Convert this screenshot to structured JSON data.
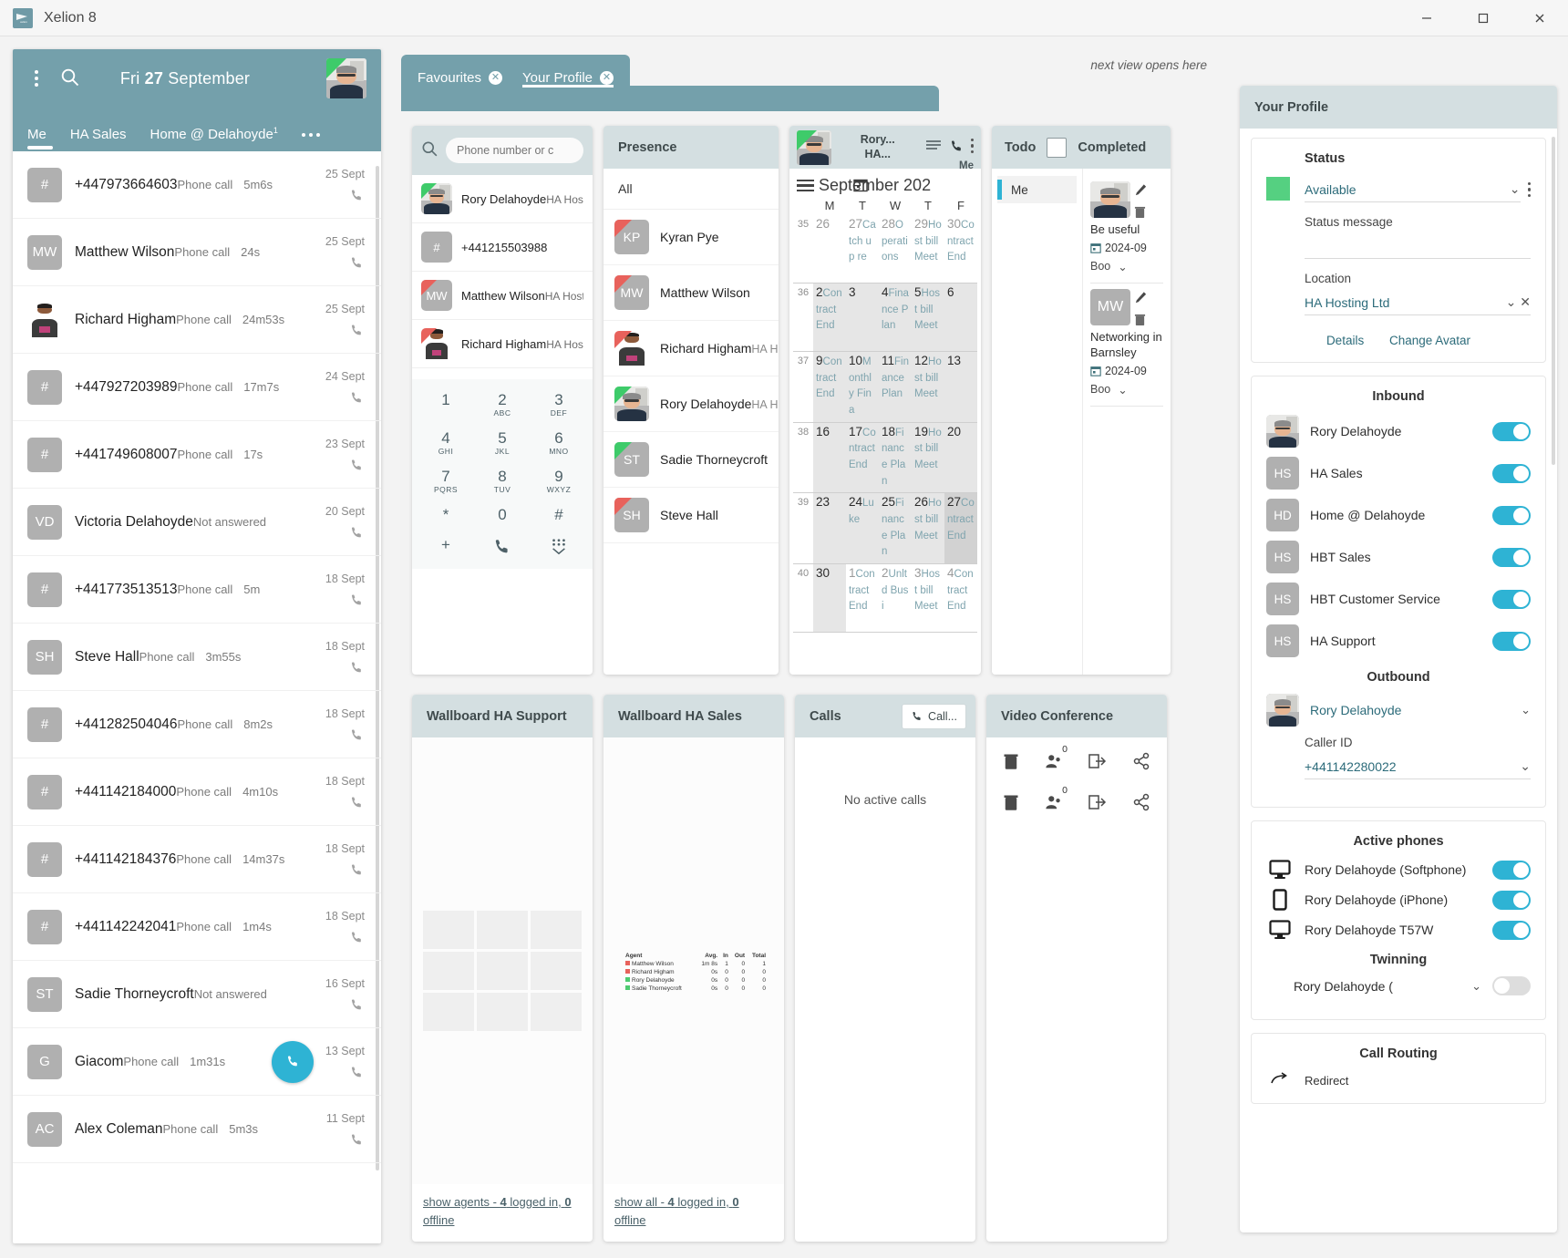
{
  "window": {
    "app_title": "Xelion 8",
    "minimize": "—",
    "maximize": "□",
    "close": "✕"
  },
  "left": {
    "date": {
      "dow": "Fri",
      "day": "27",
      "month": "September"
    },
    "tabs": [
      {
        "label": "Me",
        "badge": "",
        "active": true
      },
      {
        "label": "HA Sales",
        "badge": "",
        "active": false
      },
      {
        "label": "Home @ Delahoyde",
        "badge": "1",
        "active": false
      }
    ],
    "calls": [
      {
        "initials": "#",
        "name": "+447973664603",
        "type": "Phone call",
        "duration": "5m6s",
        "date": "25 Sept",
        "avatar": "hash"
      },
      {
        "initials": "MW",
        "name": "Matthew Wilson",
        "type": "Phone call",
        "duration": "24s",
        "date": "25 Sept",
        "avatar": "initials"
      },
      {
        "initials": "RH",
        "name": "Richard Higham",
        "type": "Phone call",
        "duration": "24m53s",
        "date": "25 Sept",
        "avatar": "richard"
      },
      {
        "initials": "#",
        "name": "+447927203989",
        "type": "Phone call",
        "duration": "17m7s",
        "date": "24 Sept",
        "avatar": "hash"
      },
      {
        "initials": "#",
        "name": "+441749608007",
        "type": "Phone call",
        "duration": "17s",
        "date": "23 Sept",
        "avatar": "hash"
      },
      {
        "initials": "VD",
        "name": "Victoria Delahoyde",
        "type": "Not answered",
        "duration": "",
        "date": "20 Sept",
        "avatar": "initials"
      },
      {
        "initials": "#",
        "name": "+441773513513",
        "type": "Phone call",
        "duration": "5m",
        "date": "18 Sept",
        "avatar": "hash"
      },
      {
        "initials": "SH",
        "name": "Steve Hall",
        "type": "Phone call",
        "duration": "3m55s",
        "date": "18 Sept",
        "avatar": "initials"
      },
      {
        "initials": "#",
        "name": "+441282504046",
        "type": "Phone call",
        "duration": "8m2s",
        "date": "18 Sept",
        "avatar": "hash"
      },
      {
        "initials": "#",
        "name": "+441142184000",
        "type": "Phone call",
        "duration": "4m10s",
        "date": "18 Sept",
        "avatar": "hash"
      },
      {
        "initials": "#",
        "name": "+441142184376",
        "type": "Phone call",
        "duration": "14m37s",
        "date": "18 Sept",
        "avatar": "hash"
      },
      {
        "initials": "#",
        "name": "+441142242041",
        "type": "Phone call",
        "duration": "1m4s",
        "date": "18 Sept",
        "avatar": "hash"
      },
      {
        "initials": "ST",
        "name": "Sadie Thorneycroft",
        "type": "Not answered",
        "duration": "",
        "date": "16 Sept",
        "avatar": "initials"
      },
      {
        "initials": "G",
        "name": "Giacom",
        "type": "Phone call",
        "duration": "1m31s",
        "date": "13 Sept",
        "avatar": "initials",
        "dial_fab": true
      },
      {
        "initials": "AC",
        "name": "Alex Coleman",
        "type": "Phone call",
        "duration": "5m3s",
        "date": "11 Sept",
        "avatar": "initials"
      }
    ]
  },
  "tabbar": {
    "tabs": [
      {
        "label": "Favourites",
        "active": false
      },
      {
        "label": "Your Profile",
        "active": true
      }
    ],
    "hint": "next view opens here"
  },
  "favourites": {
    "search_placeholder": "Phone number or c",
    "items": [
      {
        "initials": "RD",
        "name": "Rory Delahoyde",
        "org": "HA Hosting Ltd",
        "avatar": "photo",
        "corner": "green"
      },
      {
        "initials": "#",
        "name": "+441215503988",
        "org": "",
        "avatar": "hash",
        "corner": "none"
      },
      {
        "initials": "MW",
        "name": "Matthew Wilson",
        "org": "HA Hosting Ltd",
        "avatar": "initials",
        "corner": "red"
      },
      {
        "initials": "RH",
        "name": "Richard Higham",
        "org": "HA Hosting Ltd",
        "avatar": "richard",
        "corner": "red"
      }
    ],
    "dialpad": [
      {
        "d": "1",
        "l": ""
      },
      {
        "d": "2",
        "l": "ABC"
      },
      {
        "d": "3",
        "l": "DEF"
      },
      {
        "d": "4",
        "l": "GHI"
      },
      {
        "d": "5",
        "l": "JKL"
      },
      {
        "d": "6",
        "l": "MNO"
      },
      {
        "d": "7",
        "l": "PQRS"
      },
      {
        "d": "8",
        "l": "TUV"
      },
      {
        "d": "9",
        "l": "WXYZ"
      },
      {
        "d": "*",
        "l": ""
      },
      {
        "d": "0",
        "l": ""
      },
      {
        "d": "#",
        "l": ""
      }
    ]
  },
  "presence": {
    "title": "Presence",
    "all_label": "All",
    "items": [
      {
        "initials": "KP",
        "name": "Kyran Pye",
        "org": "",
        "avatar": "initials",
        "corner": "red"
      },
      {
        "initials": "MW",
        "name": "Matthew Wilson",
        "org": "",
        "avatar": "initials",
        "corner": "red"
      },
      {
        "initials": "RH",
        "name": "Richard Higham",
        "org": "HA Hosting Ltd",
        "avatar": "richard",
        "corner": "red"
      },
      {
        "initials": "RD",
        "name": "Rory Delahoyde",
        "org": "HA Hosting Ltd",
        "avatar": "photo",
        "corner": "green"
      },
      {
        "initials": "ST",
        "name": "Sadie Thorneycroft",
        "org": "",
        "avatar": "initials",
        "corner": "green"
      },
      {
        "initials": "SH",
        "name": "Steve Hall",
        "org": "",
        "avatar": "initials",
        "corner": "red"
      }
    ]
  },
  "calendar": {
    "owner_name": "Rory...",
    "owner_org": "HA...",
    "me_label": "Me",
    "title": "September 202",
    "dow": [
      "M",
      "T",
      "W",
      "T",
      "F"
    ],
    "weeks": [
      {
        "num": "35",
        "shade": false,
        "days": [
          {
            "n": "26",
            "other": true,
            "ev": ""
          },
          {
            "n": "27",
            "other": true,
            "ev": "Catch up re"
          },
          {
            "n": "28",
            "other": true,
            "ev": "Operations"
          },
          {
            "n": "29",
            "other": true,
            "ev": "Host bill Meet"
          },
          {
            "n": "30",
            "other": true,
            "ev": "Contract End"
          }
        ]
      },
      {
        "num": "36",
        "shade": true,
        "days": [
          {
            "n": "2",
            "other": false,
            "ev": "Contract End"
          },
          {
            "n": "3",
            "other": false,
            "ev": ""
          },
          {
            "n": "4",
            "other": false,
            "ev": "Finance Plan"
          },
          {
            "n": "5",
            "other": false,
            "ev": "Host bill Meet"
          },
          {
            "n": "6",
            "other": false,
            "ev": ""
          }
        ]
      },
      {
        "num": "37",
        "shade": true,
        "days": [
          {
            "n": "9",
            "other": false,
            "ev": "Contract End"
          },
          {
            "n": "10",
            "other": false,
            "ev": "Monthly Fina"
          },
          {
            "n": "11",
            "other": false,
            "ev": "Finance Plan"
          },
          {
            "n": "12",
            "other": false,
            "ev": "Host bill Meet"
          },
          {
            "n": "13",
            "other": false,
            "ev": ""
          }
        ]
      },
      {
        "num": "38",
        "shade": true,
        "days": [
          {
            "n": "16",
            "other": false,
            "ev": ""
          },
          {
            "n": "17",
            "other": false,
            "ev": "Contract End"
          },
          {
            "n": "18",
            "other": false,
            "ev": "Finance Plan"
          },
          {
            "n": "19",
            "other": false,
            "ev": "Host bill Meet"
          },
          {
            "n": "20",
            "other": false,
            "ev": ""
          }
        ]
      },
      {
        "num": "39",
        "shade": true,
        "days": [
          {
            "n": "23",
            "other": false,
            "ev": ""
          },
          {
            "n": "24",
            "other": false,
            "ev": "Luke"
          },
          {
            "n": "25",
            "other": false,
            "ev": "Finance Plan"
          },
          {
            "n": "26",
            "other": false,
            "ev": "Host bill Meet"
          },
          {
            "n": "27",
            "other": false,
            "ev": "Contract End",
            "today": true
          }
        ]
      },
      {
        "num": "40",
        "shade": true,
        "days": [
          {
            "n": "30",
            "other": false,
            "ev": ""
          },
          {
            "n": "1",
            "other": true,
            "ev": "Contract End",
            "white": true
          },
          {
            "n": "2",
            "other": true,
            "ev": "Unltd Busi",
            "white": true
          },
          {
            "n": "3",
            "other": true,
            "ev": "Host bill Meet",
            "white": true
          },
          {
            "n": "4",
            "other": true,
            "ev": "Contract End",
            "white": true
          }
        ]
      }
    ]
  },
  "todo": {
    "title": "Todo",
    "completed_label": "Completed",
    "filter": "Me",
    "items": [
      {
        "avatar": "photo",
        "initials": "RD",
        "title": "Be useful",
        "date": "2024-09",
        "select": "Boo"
      },
      {
        "avatar": "initials",
        "initials": "MW",
        "title": "Networking in Barnsley",
        "date": "2024-09",
        "select": "Boo"
      }
    ]
  },
  "wallboard_support": {
    "title": "Wallboard HA Support",
    "footer_prefix": "show agents - ",
    "footer_logged": "4",
    "footer_mid": " logged in, ",
    "footer_offline": "0",
    "footer_suffix": " offline"
  },
  "wallboard_sales": {
    "title": "Wallboard HA Sales",
    "footer_prefix": "show all - ",
    "footer_logged": "4",
    "footer_mid": " logged in, ",
    "footer_offline": "0",
    "footer_suffix": " offline",
    "table": {
      "headers": [
        "Agent",
        "Avg.",
        "In",
        "Out",
        "Total"
      ],
      "rows": [
        {
          "color": "#e8625c",
          "agent": "Matthew Wilson",
          "avg": "1m 8s",
          "in": "1",
          "out": "0",
          "total": "1"
        },
        {
          "color": "#e8625c",
          "agent": "Richard Higham",
          "avg": "0s",
          "in": "0",
          "out": "0",
          "total": "0"
        },
        {
          "color": "#4ecb71",
          "agent": "Rory Delahoyde",
          "avg": "0s",
          "in": "0",
          "out": "0",
          "total": "0"
        },
        {
          "color": "#4ecb71",
          "agent": "Sadie Thorneycroft",
          "avg": "0s",
          "in": "0",
          "out": "0",
          "total": "0"
        }
      ]
    }
  },
  "calls_panel": {
    "title": "Calls",
    "call_button": "Call...",
    "empty": "No active calls"
  },
  "video_conference": {
    "title": "Video Conference",
    "rows": [
      {
        "count": "0"
      },
      {
        "count": "0"
      }
    ]
  },
  "profile": {
    "title": "Your Profile",
    "status": {
      "heading": "Status",
      "value": "Available",
      "color": "#55d081",
      "message_label": "Status message",
      "message_value": "",
      "location_label": "Location",
      "location_value": "HA Hosting Ltd",
      "details_link": "Details",
      "avatar_link": "Change Avatar"
    },
    "inbound": {
      "heading": "Inbound",
      "items": [
        {
          "avatar": "photo",
          "initials": "RD",
          "name": "Rory Delahoyde",
          "on": true
        },
        {
          "avatar": "initials",
          "initials": "HS",
          "name": "HA Sales",
          "on": true
        },
        {
          "avatar": "initials",
          "initials": "HD",
          "name": "Home @ Delahoyde",
          "on": true
        },
        {
          "avatar": "initials",
          "initials": "HS",
          "name": "HBT Sales",
          "on": true
        },
        {
          "avatar": "initials",
          "initials": "HS",
          "name": "HBT Customer Service",
          "on": true
        },
        {
          "avatar": "initials",
          "initials": "HS",
          "name": "HA Support",
          "on": true
        }
      ]
    },
    "outbound": {
      "heading": "Outbound",
      "name": "Rory Delahoyde",
      "caller_id_label": "Caller ID",
      "caller_id_value": "+441142280022"
    },
    "active_phones": {
      "heading": "Active phones",
      "items": [
        {
          "icon": "monitor-icon",
          "name": "Rory Delahoyde (Softphone)",
          "on": true
        },
        {
          "icon": "mobile-icon",
          "name": "Rory Delahoyde (iPhone)",
          "on": true
        },
        {
          "icon": "monitor-icon",
          "name": "Rory Delahoyde T57W",
          "on": true
        }
      ]
    },
    "twinning": {
      "heading": "Twinning",
      "name": "Rory Delahoyde (",
      "on": false
    },
    "call_routing": {
      "heading": "Call Routing",
      "item": "Redirect"
    }
  }
}
